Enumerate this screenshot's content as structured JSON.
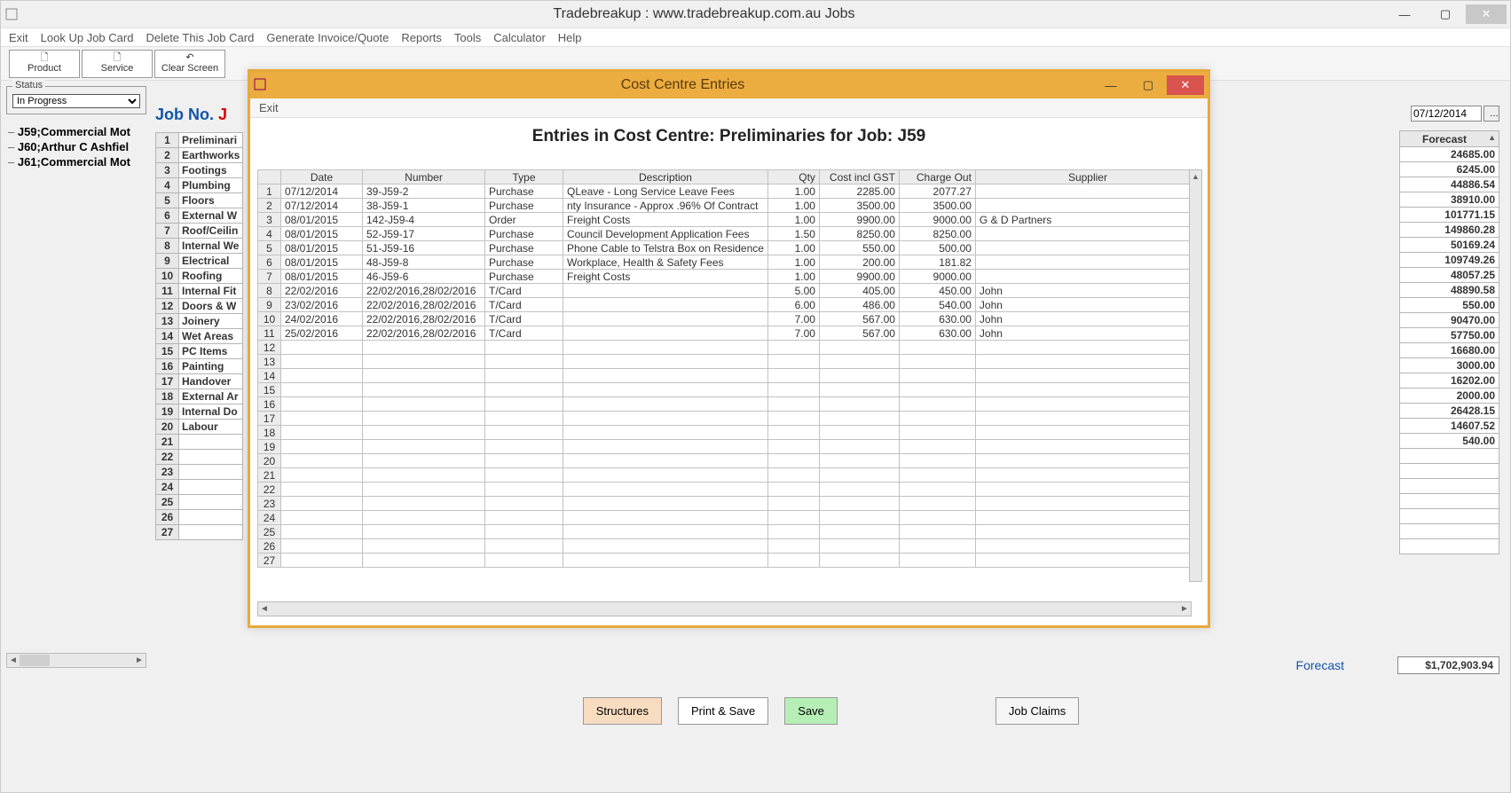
{
  "window": {
    "title": "Tradebreakup :    www.tradebreakup.com.au     Jobs",
    "date_field": "07/12/2014"
  },
  "menu": {
    "exit": "Exit",
    "lookup": "Look Up Job Card",
    "delete": "Delete This Job Card",
    "invoice": "Generate Invoice/Quote",
    "reports": "Reports",
    "tools": "Tools",
    "calculator": "Calculator",
    "help": "Help"
  },
  "toolbar": {
    "product": "Product",
    "service": "Service",
    "clear": "Clear Screen"
  },
  "status": {
    "legend": "Status",
    "value": "In Progress"
  },
  "jobs_tree": [
    "J59;Commercial Mot",
    "J60;Arthur C Ashfiel",
    "J61;Commercial Mot"
  ],
  "jobno_label": "Job No.  ",
  "jobno_value": "J",
  "costcentres": [
    "Preliminari",
    "Earthworks",
    "Footings",
    "Plumbing",
    "Floors",
    "External W",
    "Roof/Ceilin",
    "Internal We",
    "Electrical",
    "Roofing",
    "Internal Fit",
    "Doors & W",
    "Joinery",
    "Wet Areas",
    "PC Items",
    "Painting",
    "Handover",
    "External Ar",
    "Internal Do",
    "Labour",
    "",
    "",
    "",
    "",
    "",
    "",
    ""
  ],
  "forecast": {
    "header": "Forecast",
    "rows": [
      "24685.00",
      "6245.00",
      "44886.54",
      "38910.00",
      "101771.15",
      "149860.28",
      "50169.24",
      "109749.26",
      "48057.25",
      "48890.58",
      "550.00",
      "90470.00",
      "57750.00",
      "16680.00",
      "3000.00",
      "16202.00",
      "2000.00",
      "26428.15",
      "14607.52",
      "540.00",
      "",
      "",
      "",
      "",
      "",
      "",
      ""
    ]
  },
  "footer": {
    "forecast_label": "Forecast",
    "forecast_total": "$1,702,903.94"
  },
  "bottom_btns": {
    "structures": "Structures",
    "print": "Print & Save",
    "save": "Save",
    "claims": "Job Claims"
  },
  "popup": {
    "title": "Cost Centre Entries",
    "exit": "Exit",
    "heading": "Entries in Cost Centre: Preliminaries for Job: J59",
    "columns": {
      "date": "Date",
      "number": "Number",
      "type": "Type",
      "desc": "Description",
      "qty": "Qty",
      "cost": "Cost incl GST",
      "charge": "Charge Out",
      "supplier": "Supplier"
    },
    "rows": [
      {
        "n": "1",
        "date": "07/12/2014",
        "num": "39-J59-2",
        "type": "Purchase",
        "desc": "QLeave - Long Service Leave Fees",
        "qty": "1.00",
        "cost": "2285.00",
        "chg": "2077.27",
        "sup": ""
      },
      {
        "n": "2",
        "date": "07/12/2014",
        "num": "38-J59-1",
        "type": "Purchase",
        "desc": "nty Insurance -  Approx .96% Of Contract",
        "qty": "1.00",
        "cost": "3500.00",
        "chg": "3500.00",
        "sup": ""
      },
      {
        "n": "3",
        "date": "08/01/2015",
        "num": "142-J59-4",
        "type": "Order",
        "desc": "Freight Costs",
        "qty": "1.00",
        "cost": "9900.00",
        "chg": "9000.00",
        "sup": "G & D Partners"
      },
      {
        "n": "4",
        "date": "08/01/2015",
        "num": "52-J59-17",
        "type": "Purchase",
        "desc": "Council Development Application Fees",
        "qty": "1.50",
        "cost": "8250.00",
        "chg": "8250.00",
        "sup": ""
      },
      {
        "n": "5",
        "date": "08/01/2015",
        "num": "51-J59-16",
        "type": "Purchase",
        "desc": " Phone Cable to Telstra Box on Residence",
        "qty": "1.00",
        "cost": "550.00",
        "chg": "500.00",
        "sup": ""
      },
      {
        "n": "6",
        "date": "08/01/2015",
        "num": "48-J59-8",
        "type": "Purchase",
        "desc": "Workplace, Health & Safety Fees",
        "qty": "1.00",
        "cost": "200.00",
        "chg": "181.82",
        "sup": ""
      },
      {
        "n": "7",
        "date": "08/01/2015",
        "num": "46-J59-6",
        "type": "Purchase",
        "desc": "Freight Costs",
        "qty": "1.00",
        "cost": "9900.00",
        "chg": "9000.00",
        "sup": ""
      },
      {
        "n": "8",
        "date": "22/02/2016",
        "num": "22/02/2016,28/02/2016",
        "type": "T/Card",
        "desc": "",
        "qty": "5.00",
        "cost": "405.00",
        "chg": "450.00",
        "sup": "John"
      },
      {
        "n": "9",
        "date": "23/02/2016",
        "num": "22/02/2016,28/02/2016",
        "type": "T/Card",
        "desc": "",
        "qty": "6.00",
        "cost": "486.00",
        "chg": "540.00",
        "sup": "John"
      },
      {
        "n": "10",
        "date": "24/02/2016",
        "num": "22/02/2016,28/02/2016",
        "type": "T/Card",
        "desc": "",
        "qty": "7.00",
        "cost": "567.00",
        "chg": "630.00",
        "sup": "John"
      },
      {
        "n": "11",
        "date": "25/02/2016",
        "num": "22/02/2016,28/02/2016",
        "type": "T/Card",
        "desc": "",
        "qty": "7.00",
        "cost": "567.00",
        "chg": "630.00",
        "sup": "John"
      }
    ],
    "blank_start": 12,
    "blank_end": 27
  }
}
